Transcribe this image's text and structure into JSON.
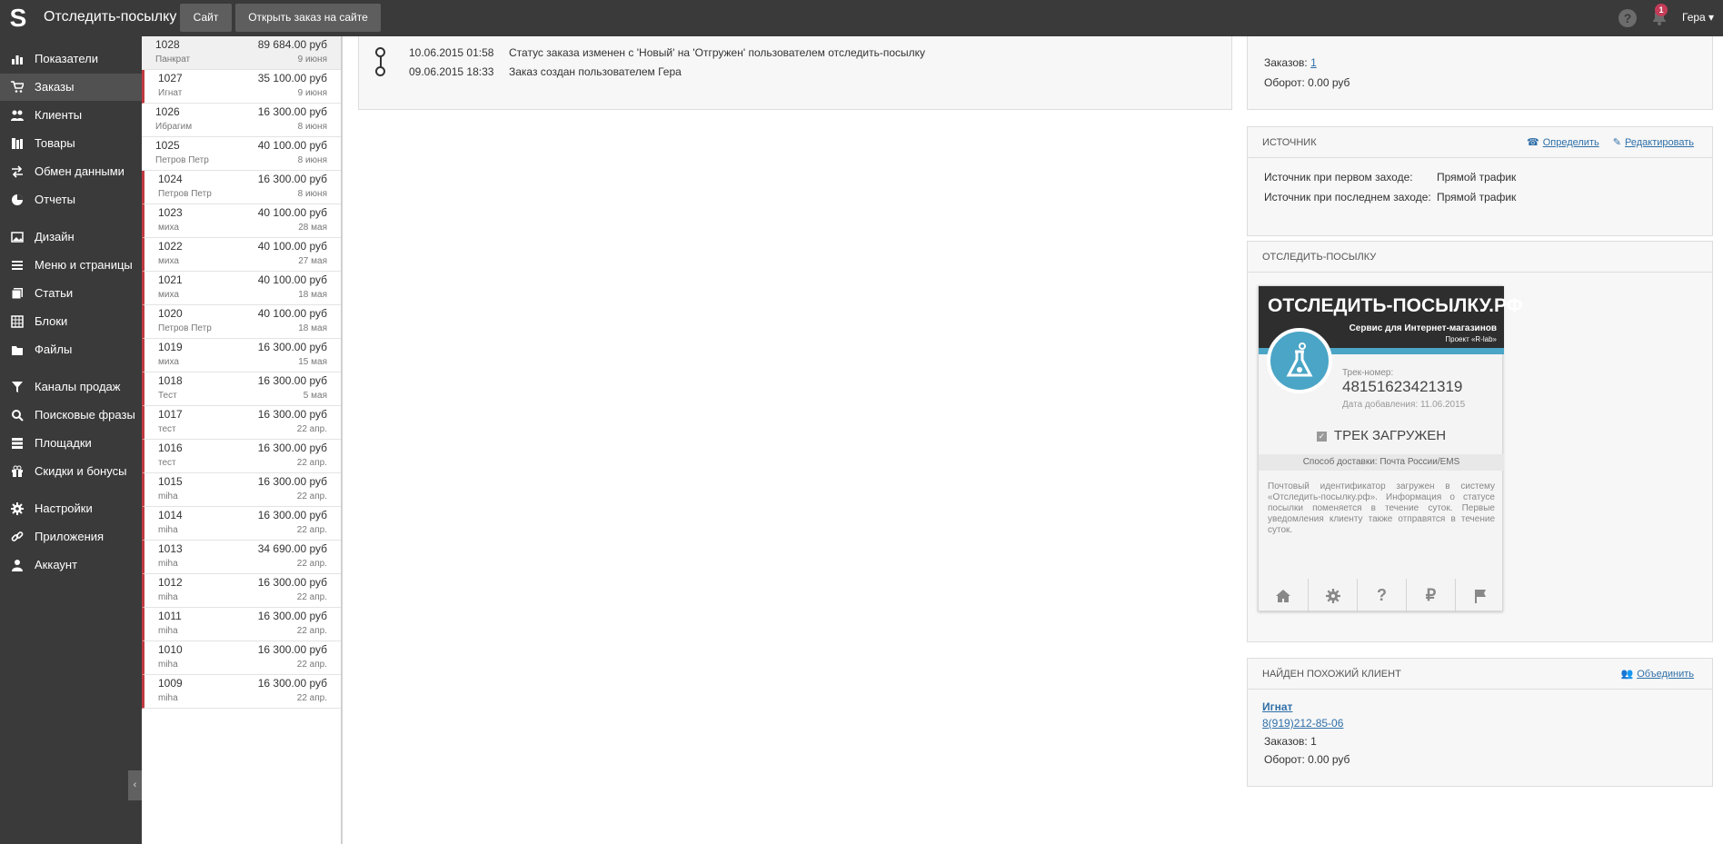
{
  "topbar": {
    "title": "Отследить-посылку",
    "btn_site": "Сайт",
    "btn_open": "Открыть заказ на сайте",
    "help": "?",
    "badge": "1",
    "user": "Гера ▾"
  },
  "sidebar": {
    "items": [
      {
        "label": "Показатели",
        "icon": "chart-icon"
      },
      {
        "label": "Заказы",
        "icon": "cart-icon"
      },
      {
        "label": "Клиенты",
        "icon": "users-icon"
      },
      {
        "label": "Товары",
        "icon": "books-icon"
      },
      {
        "label": "Обмен данными",
        "icon": "exchange-icon"
      },
      {
        "label": "Отчеты",
        "icon": "pie-icon"
      },
      {
        "label": "Дизайн",
        "icon": "image-icon"
      },
      {
        "label": "Меню и страницы",
        "icon": "list-icon"
      },
      {
        "label": "Статьи",
        "icon": "pages-icon"
      },
      {
        "label": "Блоки",
        "icon": "grid-icon"
      },
      {
        "label": "Файлы",
        "icon": "folder-icon"
      },
      {
        "label": "Каналы продаж",
        "icon": "filter-icon"
      },
      {
        "label": "Поисковые фразы",
        "icon": "search-icon"
      },
      {
        "label": "Площадки",
        "icon": "rows-icon"
      },
      {
        "label": "Скидки и бонусы",
        "icon": "gift-icon"
      },
      {
        "label": "Настройки",
        "icon": "gear-icon"
      },
      {
        "label": "Приложения",
        "icon": "link-icon"
      },
      {
        "label": "Аккаунт",
        "icon": "person-icon"
      }
    ],
    "collapse": "‹"
  },
  "orders": [
    {
      "num": "1028",
      "sum": "89 684.00 руб",
      "name": "Панкрат",
      "date": "9 июня"
    },
    {
      "num": "1027",
      "sum": "35 100.00 руб",
      "name": "Игнат",
      "date": "9 июня"
    },
    {
      "num": "1026",
      "sum": "16 300.00 руб",
      "name": "Ибрагим",
      "date": "8 июня"
    },
    {
      "num": "1025",
      "sum": "40 100.00 руб",
      "name": "Петров Петр",
      "date": "8 июня"
    },
    {
      "num": "1024",
      "sum": "16 300.00 руб",
      "name": "Петров Петр",
      "date": "8 июня"
    },
    {
      "num": "1023",
      "sum": "40 100.00 руб",
      "name": "миха",
      "date": "28 мая"
    },
    {
      "num": "1022",
      "sum": "40 100.00 руб",
      "name": "миха",
      "date": "27 мая"
    },
    {
      "num": "1021",
      "sum": "40 100.00 руб",
      "name": "миха",
      "date": "18 мая"
    },
    {
      "num": "1020",
      "sum": "40 100.00 руб",
      "name": "Петров Петр",
      "date": "18 мая"
    },
    {
      "num": "1019",
      "sum": "16 300.00 руб",
      "name": "миха",
      "date": "15 мая"
    },
    {
      "num": "1018",
      "sum": "16 300.00 руб",
      "name": "Тест",
      "date": "5 мая"
    },
    {
      "num": "1017",
      "sum": "16 300.00 руб",
      "name": "тест",
      "date": "22 апр."
    },
    {
      "num": "1016",
      "sum": "16 300.00 руб",
      "name": "тест",
      "date": "22 апр."
    },
    {
      "num": "1015",
      "sum": "16 300.00 руб",
      "name": "miha",
      "date": "22 апр."
    },
    {
      "num": "1014",
      "sum": "16 300.00 руб",
      "name": "miha",
      "date": "22 апр."
    },
    {
      "num": "1013",
      "sum": "34 690.00 руб",
      "name": "miha",
      "date": "22 апр."
    },
    {
      "num": "1012",
      "sum": "16 300.00 руб",
      "name": "miha",
      "date": "22 апр."
    },
    {
      "num": "1011",
      "sum": "16 300.00 руб",
      "name": "miha",
      "date": "22 апр."
    },
    {
      "num": "1010",
      "sum": "16 300.00 руб",
      "name": "miha",
      "date": "22 апр."
    },
    {
      "num": "1009",
      "sum": "16 300.00 руб",
      "name": "miha",
      "date": "22 апр."
    }
  ],
  "history": [
    {
      "date": "10.06.2015 01:58",
      "text": "Статус заказа изменен с 'Новый' на 'Отгружен' пользователем отследить-посылку"
    },
    {
      "date": "09.06.2015 18:33",
      "text": "Заказ создан пользователем Гера"
    }
  ],
  "customer_stats": {
    "orders_label": "Заказов:",
    "orders_value": "1",
    "turnover_label": "Оборот:",
    "turnover_value": "0.00 руб"
  },
  "source": {
    "title": "Источник",
    "link_detect": "Определить",
    "link_edit": "Редактировать",
    "first_label": "Источник при первом заходе:",
    "first_value": "Прямой трафик",
    "last_label": "Источник при последнем заходе:",
    "last_value": "Прямой трафик"
  },
  "tracking": {
    "title": "Отследить-посылку",
    "brand": "ОТСЛЕДИТЬ-ПОСЫЛКУ.РФ",
    "brand_sub": "Сервис для Интернет-магазинов",
    "brand_sub2": "Проект «R-lab»",
    "track_label": "Трек-номер:",
    "track_number": "48151623421319",
    "added_date": "Дата добавления: 11.06.2015",
    "status": "ТРЕК ЗАГРУЖЕН",
    "delivery": "Способ доставки: Почта России/EMS",
    "description": "Почтовый идентификатор загружен в систему «Отследить-посылку.рф». Информация о статусе посылки поменяется в течение суток. Первые уведомления клиенту также отправятся в течение суток.",
    "tabs": [
      "home-icon",
      "gear-icon",
      "help-icon",
      "ruble-icon",
      "flag-icon"
    ]
  },
  "similar": {
    "title": "Найден похожий клиент",
    "link_merge": "Объединить",
    "name": "Игнат",
    "phone": "8(919)212-85-06",
    "orders_label": "Заказов:",
    "orders_value": "1",
    "turnover_label": "Оборот:",
    "turnover_value": "0.00 руб"
  },
  "colors": {
    "topbar": "#3a3a3a",
    "accent": "#4aa5c6",
    "marker": "#c0393f",
    "link": "#2f6fa8"
  }
}
